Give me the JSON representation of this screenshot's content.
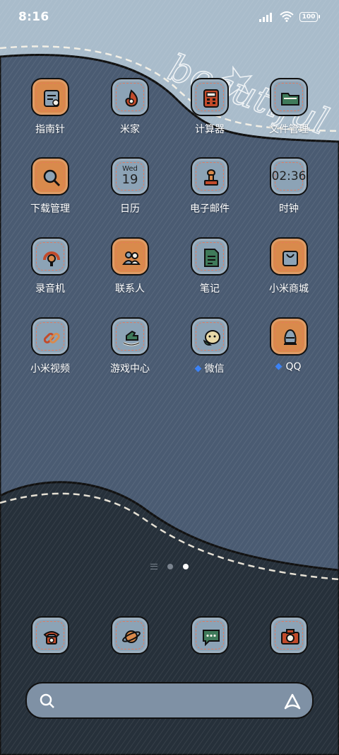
{
  "status_bar": {
    "time": "8:16",
    "battery": "100"
  },
  "wallpaper": {
    "text": "beautiful"
  },
  "apps": [
    {
      "label": "指南针",
      "icon": "compass-icon",
      "style": "orange"
    },
    {
      "label": "米家",
      "icon": "mijia-icon",
      "style": "blue"
    },
    {
      "label": "计算器",
      "icon": "calculator-icon",
      "style": "blue"
    },
    {
      "label": "文件管理",
      "icon": "folder-icon",
      "style": "blue"
    },
    {
      "label": "下载管理",
      "icon": "download-icon",
      "style": "orange"
    },
    {
      "label": "日历",
      "icon": "calendar-icon",
      "style": "blue",
      "weekday": "Wed",
      "day": "19"
    },
    {
      "label": "电子邮件",
      "icon": "stamp-icon",
      "style": "blue"
    },
    {
      "label": "时钟",
      "icon": "clock-icon",
      "style": "blue",
      "clock_text": "02:36"
    },
    {
      "label": "录音机",
      "icon": "recorder-icon",
      "style": "blue"
    },
    {
      "label": "联系人",
      "icon": "contacts-icon",
      "style": "orange"
    },
    {
      "label": "笔记",
      "icon": "notes-icon",
      "style": "blue"
    },
    {
      "label": "小米商城",
      "icon": "shop-bag-icon",
      "style": "orange"
    },
    {
      "label": "小米视频",
      "icon": "video-link-icon",
      "style": "blue"
    },
    {
      "label": "游戏中心",
      "icon": "rocking-horse-icon",
      "style": "blue"
    },
    {
      "label": "微信",
      "icon": "wechat-icon",
      "style": "blue",
      "new": true
    },
    {
      "label": "QQ",
      "icon": "qq-icon",
      "style": "orange",
      "new": true
    }
  ],
  "dock": [
    {
      "name": "phone",
      "icon": "phone-icon"
    },
    {
      "name": "browser",
      "icon": "planet-icon"
    },
    {
      "name": "messages",
      "icon": "message-icon"
    },
    {
      "name": "camera",
      "icon": "camera-icon"
    }
  ],
  "colors": {
    "denim_light": "#a9bccb",
    "denim_mid": "#4a5b72",
    "denim_dark": "#26303a",
    "icon_orange": "#d98a4c",
    "icon_blue": "#8ca3b6",
    "stitch": "#e6785a"
  }
}
